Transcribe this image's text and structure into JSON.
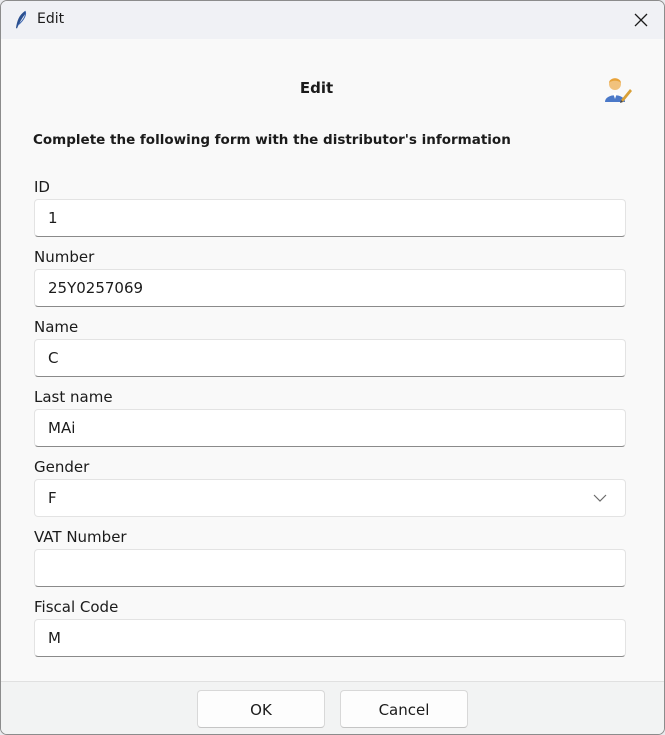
{
  "window": {
    "title": "Edit",
    "app_icon": "feather-icon",
    "close_icon": "close-icon"
  },
  "header": {
    "title": "Edit",
    "icon": "user-edit-icon"
  },
  "instructions": "Complete the following form with the distributor's information",
  "fields": {
    "id": {
      "label": "ID",
      "value": "1"
    },
    "number": {
      "label": "Number",
      "value": "25Y0257069"
    },
    "name": {
      "label": "Name",
      "value": "C"
    },
    "last_name": {
      "label": "Last name",
      "value": "MAi"
    },
    "gender": {
      "label": "Gender",
      "value": "F",
      "icon": "chevron-down-icon"
    },
    "vat_number": {
      "label": "VAT Number",
      "value": ""
    },
    "fiscal_code": {
      "label": "Fiscal Code",
      "value": "M"
    }
  },
  "buttons": {
    "ok": "OK",
    "cancel": "Cancel"
  },
  "colors": {
    "accent": "#2a5aa8",
    "window_bg": "#f9f9f9",
    "titlebar_bg": "#f0f1f5"
  }
}
